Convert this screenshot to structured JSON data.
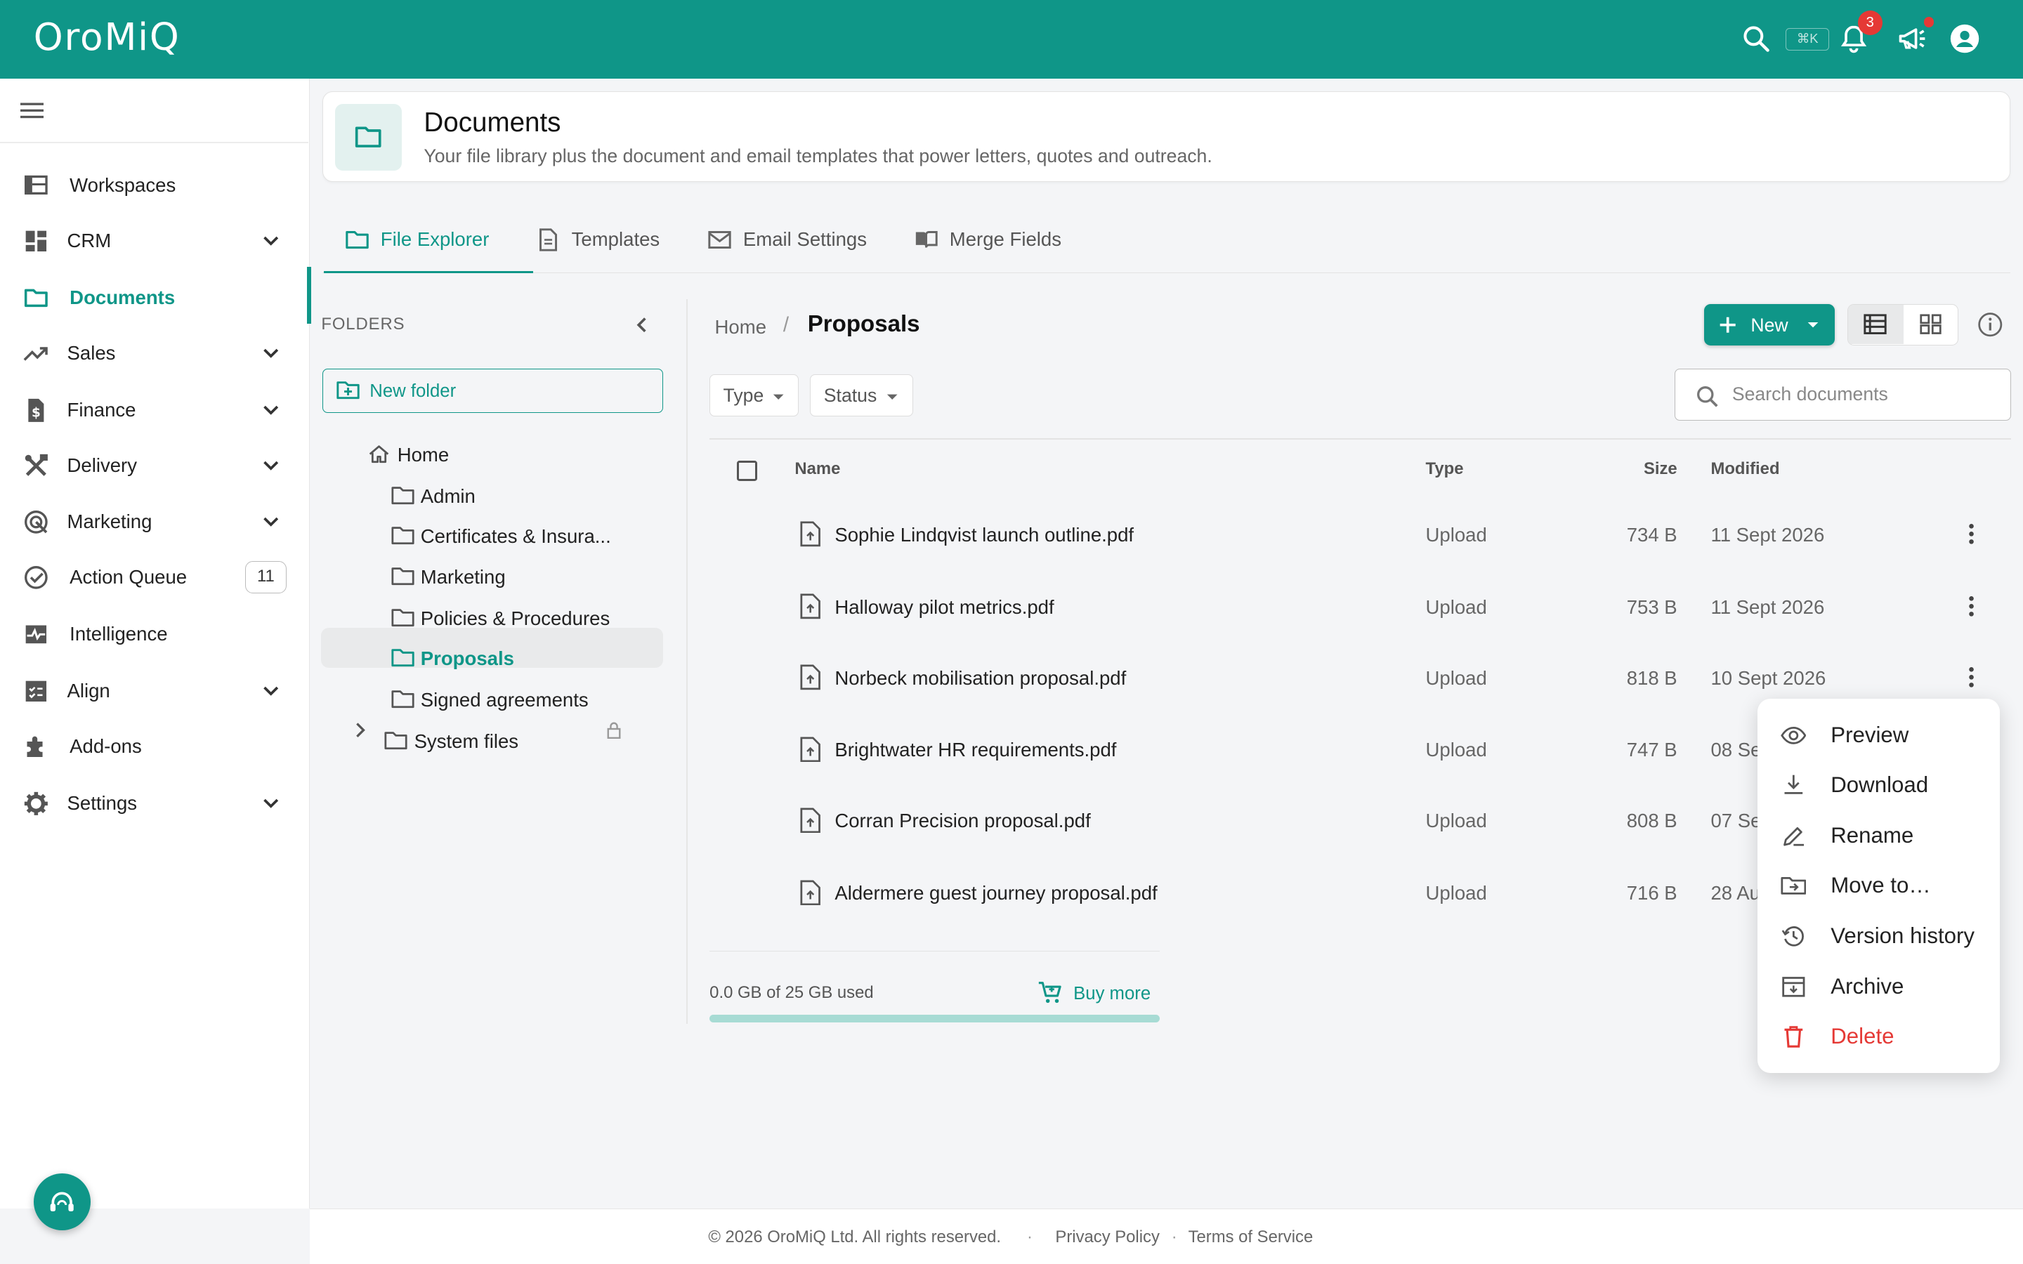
{
  "app": {
    "logo": "OroMiQ",
    "shortcut": "⌘K",
    "notification_count": "3"
  },
  "colors": {
    "accent": "#0f9688",
    "danger": "#e53935",
    "accent_light": "#e3f1ef"
  },
  "sidebar": {
    "items": [
      {
        "label": "Workspaces",
        "icon": "workspaces-icon"
      },
      {
        "label": "CRM",
        "icon": "dashboard-icon",
        "expandable": true
      },
      {
        "label": "Documents",
        "icon": "folder-icon",
        "active": true
      },
      {
        "label": "Sales",
        "icon": "trending-up-icon",
        "expandable": true
      },
      {
        "label": "Finance",
        "icon": "invoice-icon",
        "expandable": true
      },
      {
        "label": "Delivery",
        "icon": "tools-icon",
        "expandable": true
      },
      {
        "label": "Marketing",
        "icon": "target-icon",
        "expandable": true
      },
      {
        "label": "Action Queue",
        "icon": "check-circle-icon",
        "badge": "11"
      },
      {
        "label": "Intelligence",
        "icon": "pulse-icon"
      },
      {
        "label": "Align",
        "icon": "checklist-icon",
        "expandable": true
      },
      {
        "label": "Add-ons",
        "icon": "puzzle-icon"
      },
      {
        "label": "Settings",
        "icon": "gear-icon",
        "expandable": true
      }
    ]
  },
  "header": {
    "title": "Documents",
    "subtitle": "Your file library plus the document and email templates that power letters, quotes and outreach."
  },
  "tabs": [
    {
      "label": "File Explorer",
      "active": true
    },
    {
      "label": "Templates"
    },
    {
      "label": "Email Settings"
    },
    {
      "label": "Merge Fields"
    }
  ],
  "folders": {
    "label": "FOLDERS",
    "new_folder": "New folder",
    "tree": [
      {
        "label": "Home"
      },
      {
        "label": "Admin"
      },
      {
        "label": "Certificates & Insura..."
      },
      {
        "label": "Marketing"
      },
      {
        "label": "Policies & Procedures"
      },
      {
        "label": "Proposals",
        "active": true
      },
      {
        "label": "Signed agreements"
      },
      {
        "label": "System files",
        "locked": true
      }
    ]
  },
  "breadcrumb": {
    "home": "Home",
    "separator": "/",
    "current": "Proposals"
  },
  "toolbar": {
    "new_label": "New",
    "search_placeholder": "Search documents"
  },
  "filters": {
    "type": "Type",
    "status": "Status"
  },
  "table": {
    "headers": {
      "name": "Name",
      "type": "Type",
      "size": "Size",
      "modified": "Modified"
    },
    "rows": [
      {
        "name": "Sophie Lindqvist launch outline.pdf",
        "type": "Upload",
        "size": "734 B",
        "modified": "11 Sept 2026"
      },
      {
        "name": "Halloway pilot metrics.pdf",
        "type": "Upload",
        "size": "753 B",
        "modified": "11 Sept 2026"
      },
      {
        "name": "Norbeck mobilisation proposal.pdf",
        "type": "Upload",
        "size": "818 B",
        "modified": "10 Sept 2026"
      },
      {
        "name": "Brightwater HR requirements.pdf",
        "type": "Upload",
        "size": "747 B",
        "modified": "08 Se"
      },
      {
        "name": "Corran Precision proposal.pdf",
        "type": "Upload",
        "size": "808 B",
        "modified": "07 Se"
      },
      {
        "name": "Aldermere guest journey proposal.pdf",
        "type": "Upload",
        "size": "716 B",
        "modified": "28 Au"
      }
    ]
  },
  "storage": {
    "text": "0.0 GB of 25 GB used",
    "buy_more": "Buy more",
    "used_fraction": 0.0
  },
  "context_menu": [
    {
      "label": "Preview",
      "icon": "eye-icon"
    },
    {
      "label": "Download",
      "icon": "download-icon"
    },
    {
      "label": "Rename",
      "icon": "edit-icon"
    },
    {
      "label": "Move to…",
      "icon": "move-folder-icon"
    },
    {
      "label": "Version history",
      "icon": "history-icon"
    },
    {
      "label": "Archive",
      "icon": "archive-icon"
    },
    {
      "label": "Delete",
      "icon": "trash-icon",
      "danger": true
    }
  ],
  "footer": {
    "copyright": "© 2026 OroMiQ Ltd. All rights reserved.",
    "dot": "·",
    "privacy": "Privacy Policy",
    "terms": "Terms of Service"
  }
}
